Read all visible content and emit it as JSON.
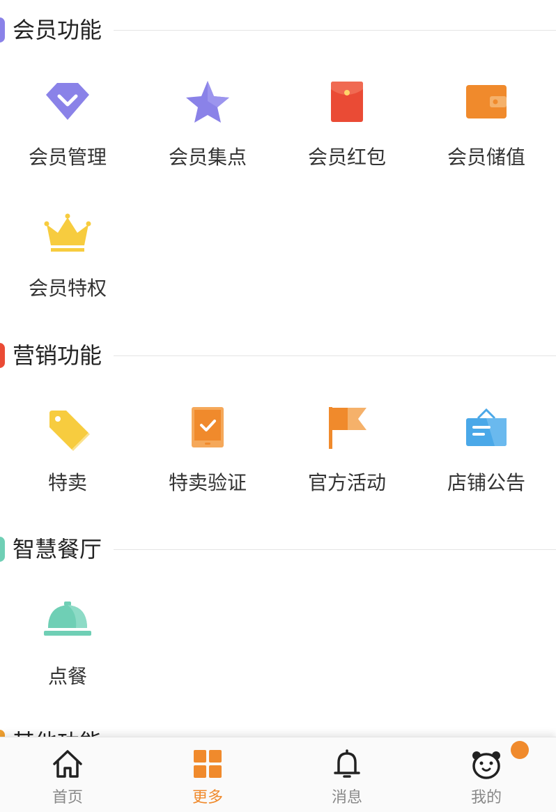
{
  "sections": [
    {
      "title": "会员功能",
      "marker_color": "#8a82e8",
      "items": [
        {
          "label": "会员管理",
          "icon": "diamond-icon"
        },
        {
          "label": "会员集点",
          "icon": "star-icon"
        },
        {
          "label": "会员红包",
          "icon": "red-envelope-icon"
        },
        {
          "label": "会员储值",
          "icon": "wallet-icon"
        },
        {
          "label": "会员特权",
          "icon": "crown-icon"
        }
      ]
    },
    {
      "title": "营销功能",
      "marker_color": "#ea4b35",
      "items": [
        {
          "label": "特卖",
          "icon": "price-tag-icon"
        },
        {
          "label": "特卖验证",
          "icon": "tablet-check-icon"
        },
        {
          "label": "官方活动",
          "icon": "flag-icon"
        },
        {
          "label": "店铺公告",
          "icon": "notice-board-icon"
        }
      ]
    },
    {
      "title": "智慧餐厅",
      "marker_color": "#6fcfb5",
      "items": [
        {
          "label": "点餐",
          "icon": "food-cloche-icon"
        }
      ]
    },
    {
      "title": "其他功能",
      "marker_color": "#f0a030",
      "items": []
    }
  ],
  "tabbar": {
    "active_color": "#f08a2c",
    "tabs": [
      {
        "label": "首页",
        "icon": "home-icon",
        "active": false
      },
      {
        "label": "更多",
        "icon": "grid-icon",
        "active": true
      },
      {
        "label": "消息",
        "icon": "bell-icon",
        "active": false
      },
      {
        "label": "我的",
        "icon": "bear-avatar-icon",
        "active": false,
        "badge": true
      }
    ]
  }
}
